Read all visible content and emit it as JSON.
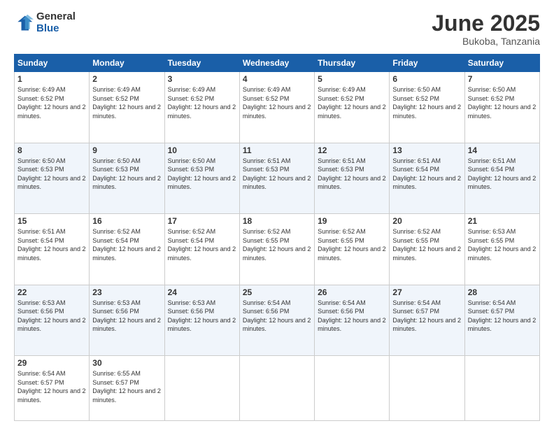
{
  "logo": {
    "general": "General",
    "blue": "Blue"
  },
  "title": "June 2025",
  "location": "Bukoba, Tanzania",
  "days_of_week": [
    "Sunday",
    "Monday",
    "Tuesday",
    "Wednesday",
    "Thursday",
    "Friday",
    "Saturday"
  ],
  "weeks": [
    [
      {
        "day": "1",
        "sunrise": "6:49 AM",
        "sunset": "6:52 PM",
        "daylight": "12 hours and 2 minutes."
      },
      {
        "day": "2",
        "sunrise": "6:49 AM",
        "sunset": "6:52 PM",
        "daylight": "12 hours and 2 minutes."
      },
      {
        "day": "3",
        "sunrise": "6:49 AM",
        "sunset": "6:52 PM",
        "daylight": "12 hours and 2 minutes."
      },
      {
        "day": "4",
        "sunrise": "6:49 AM",
        "sunset": "6:52 PM",
        "daylight": "12 hours and 2 minutes."
      },
      {
        "day": "5",
        "sunrise": "6:49 AM",
        "sunset": "6:52 PM",
        "daylight": "12 hours and 2 minutes."
      },
      {
        "day": "6",
        "sunrise": "6:50 AM",
        "sunset": "6:52 PM",
        "daylight": "12 hours and 2 minutes."
      },
      {
        "day": "7",
        "sunrise": "6:50 AM",
        "sunset": "6:52 PM",
        "daylight": "12 hours and 2 minutes."
      }
    ],
    [
      {
        "day": "8",
        "sunrise": "6:50 AM",
        "sunset": "6:53 PM",
        "daylight": "12 hours and 2 minutes."
      },
      {
        "day": "9",
        "sunrise": "6:50 AM",
        "sunset": "6:53 PM",
        "daylight": "12 hours and 2 minutes."
      },
      {
        "day": "10",
        "sunrise": "6:50 AM",
        "sunset": "6:53 PM",
        "daylight": "12 hours and 2 minutes."
      },
      {
        "day": "11",
        "sunrise": "6:51 AM",
        "sunset": "6:53 PM",
        "daylight": "12 hours and 2 minutes."
      },
      {
        "day": "12",
        "sunrise": "6:51 AM",
        "sunset": "6:53 PM",
        "daylight": "12 hours and 2 minutes."
      },
      {
        "day": "13",
        "sunrise": "6:51 AM",
        "sunset": "6:54 PM",
        "daylight": "12 hours and 2 minutes."
      },
      {
        "day": "14",
        "sunrise": "6:51 AM",
        "sunset": "6:54 PM",
        "daylight": "12 hours and 2 minutes."
      }
    ],
    [
      {
        "day": "15",
        "sunrise": "6:51 AM",
        "sunset": "6:54 PM",
        "daylight": "12 hours and 2 minutes."
      },
      {
        "day": "16",
        "sunrise": "6:52 AM",
        "sunset": "6:54 PM",
        "daylight": "12 hours and 2 minutes."
      },
      {
        "day": "17",
        "sunrise": "6:52 AM",
        "sunset": "6:54 PM",
        "daylight": "12 hours and 2 minutes."
      },
      {
        "day": "18",
        "sunrise": "6:52 AM",
        "sunset": "6:55 PM",
        "daylight": "12 hours and 2 minutes."
      },
      {
        "day": "19",
        "sunrise": "6:52 AM",
        "sunset": "6:55 PM",
        "daylight": "12 hours and 2 minutes."
      },
      {
        "day": "20",
        "sunrise": "6:52 AM",
        "sunset": "6:55 PM",
        "daylight": "12 hours and 2 minutes."
      },
      {
        "day": "21",
        "sunrise": "6:53 AM",
        "sunset": "6:55 PM",
        "daylight": "12 hours and 2 minutes."
      }
    ],
    [
      {
        "day": "22",
        "sunrise": "6:53 AM",
        "sunset": "6:56 PM",
        "daylight": "12 hours and 2 minutes."
      },
      {
        "day": "23",
        "sunrise": "6:53 AM",
        "sunset": "6:56 PM",
        "daylight": "12 hours and 2 minutes."
      },
      {
        "day": "24",
        "sunrise": "6:53 AM",
        "sunset": "6:56 PM",
        "daylight": "12 hours and 2 minutes."
      },
      {
        "day": "25",
        "sunrise": "6:54 AM",
        "sunset": "6:56 PM",
        "daylight": "12 hours and 2 minutes."
      },
      {
        "day": "26",
        "sunrise": "6:54 AM",
        "sunset": "6:56 PM",
        "daylight": "12 hours and 2 minutes."
      },
      {
        "day": "27",
        "sunrise": "6:54 AM",
        "sunset": "6:57 PM",
        "daylight": "12 hours and 2 minutes."
      },
      {
        "day": "28",
        "sunrise": "6:54 AM",
        "sunset": "6:57 PM",
        "daylight": "12 hours and 2 minutes."
      }
    ],
    [
      {
        "day": "29",
        "sunrise": "6:54 AM",
        "sunset": "6:57 PM",
        "daylight": "12 hours and 2 minutes."
      },
      {
        "day": "30",
        "sunrise": "6:55 AM",
        "sunset": "6:57 PM",
        "daylight": "12 hours and 2 minutes."
      },
      null,
      null,
      null,
      null,
      null
    ]
  ]
}
